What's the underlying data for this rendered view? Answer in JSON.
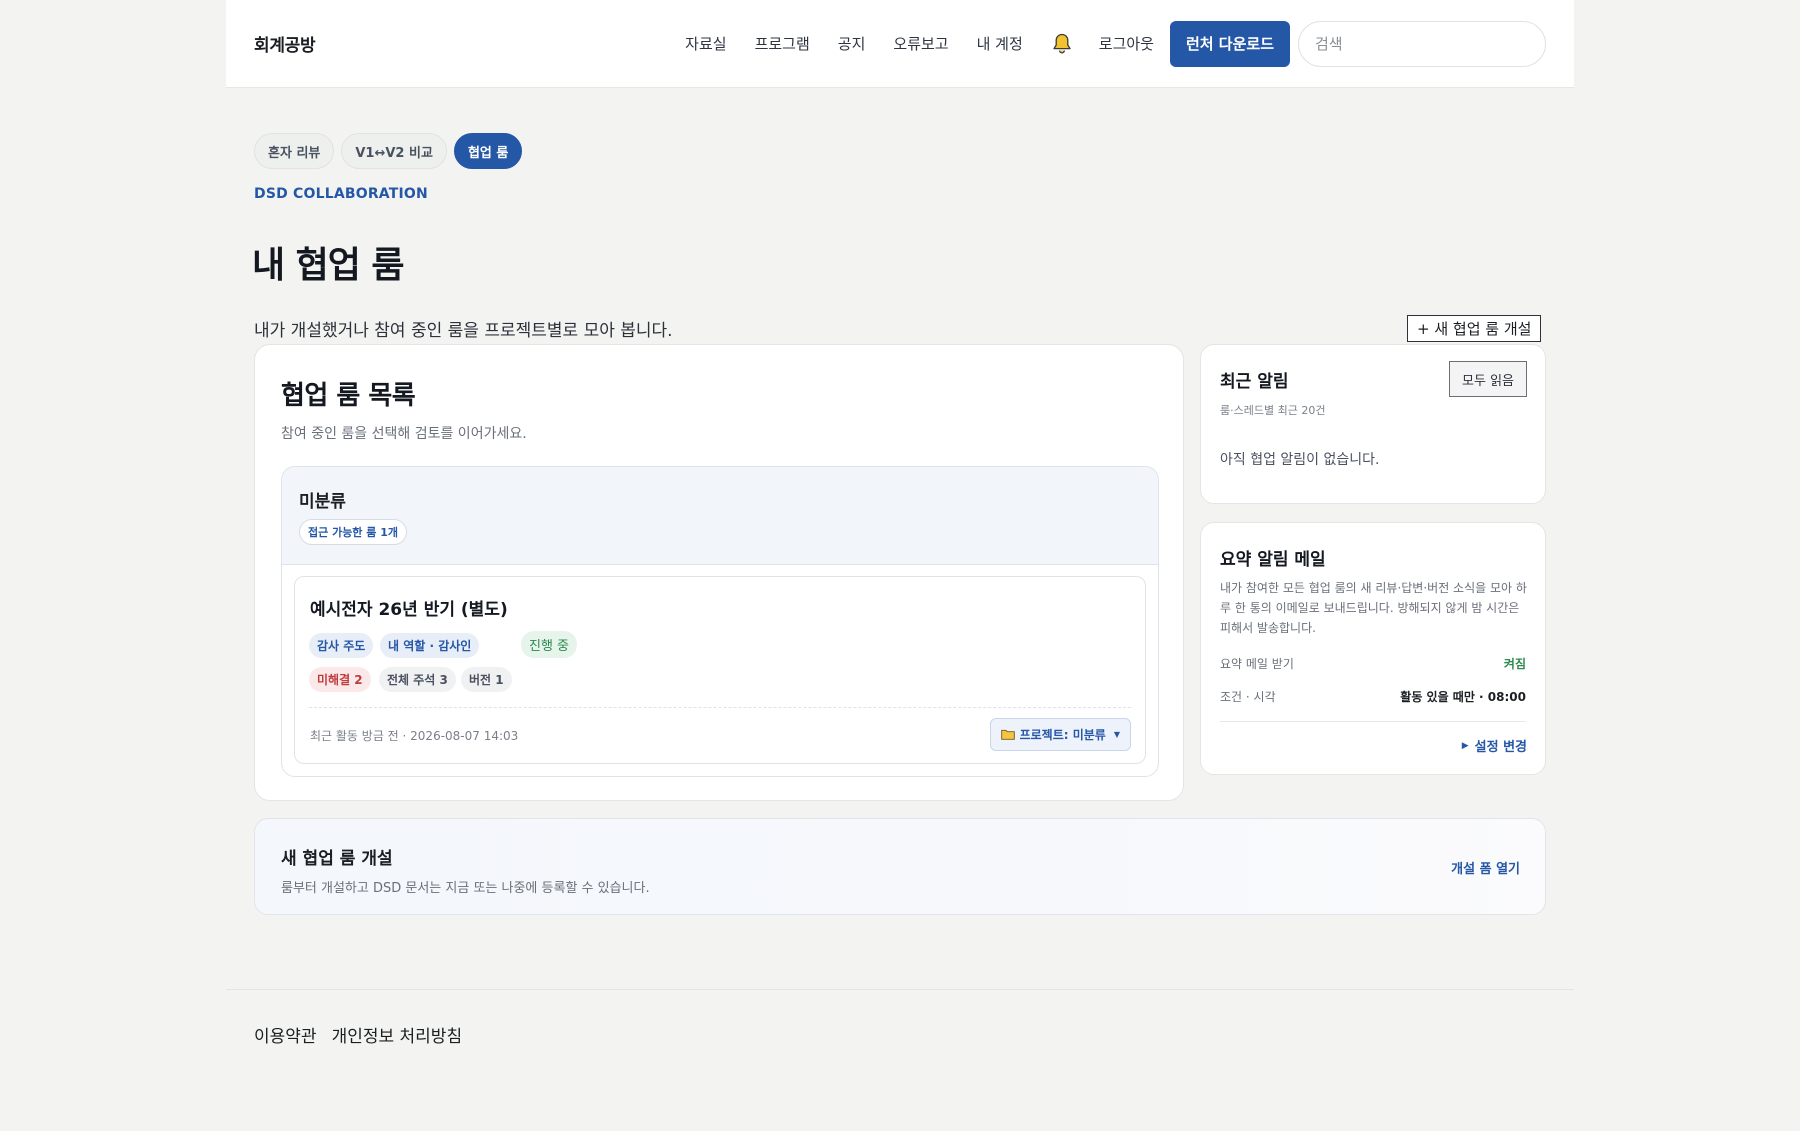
{
  "header": {
    "logo": "회계공방",
    "nav": [
      "자료실",
      "프로그램",
      "공지",
      "오류보고",
      "내 계정"
    ],
    "logout": "로그아웃",
    "download": "런처 다운로드",
    "search_placeholder": "검색"
  },
  "tabs": [
    "혼자 리뷰",
    "V1↔V2 비교",
    "협업 룸"
  ],
  "eyebrow": "DSD COLLABORATION",
  "title": "내 협업 룸",
  "description": "내가 개설했거나 참여 중인 룸을 프로젝트별로 모아 봅니다.",
  "new_room_button": "+ 새 협업 룸 개설",
  "room_list": {
    "title": "협업 룸 목록",
    "subtitle": "참여 중인 룸을 선택해 검토를 이어가세요.",
    "group": {
      "name": "미분류",
      "count": "접근 가능한 룸 1개",
      "room": {
        "name": "예시전자 26년 반기 (별도)",
        "lead": "감사 주도",
        "role": "내 역할 · 감사인",
        "status": "진행 중",
        "unresolved": "미해결 2",
        "comments": "전체 주석 3",
        "version": "버전 1",
        "activity": "최근 활동 방금 전 · 2026-08-07 14:03",
        "project": "프로젝트: 미분류"
      }
    }
  },
  "alerts": {
    "title": "최근 알림",
    "subtitle": "룸·스레드별 최근 20건",
    "read_all": "모두 읽음",
    "empty": "아직 협업 알림이 없습니다."
  },
  "digest": {
    "title": "요약 알림 메일",
    "description": "내가 참여한 모든 협업 룸의 새 리뷰·답변·버전 소식을 모아 하루 한 통의 이메일로 보내드립니다. 방해되지 않게 밤 시간은 피해서 발송합니다.",
    "receive_label": "요약 메일 받기",
    "receive_value": "켜짐",
    "condition_label": "조건 · 시각",
    "condition_value": "활동 있을 때만 · 08:00",
    "settings_link": "설정 변경"
  },
  "create": {
    "title": "새 협업 룸 개설",
    "subtitle": "룸부터 개설하고 DSD 문서는 지금 또는 나중에 등록할 수 있습니다.",
    "link": "개설 폼 열기"
  },
  "footer": [
    "이용약관",
    "개인정보 처리방침"
  ],
  "colors": {
    "accent": "#2557a7",
    "success": "#2b8a4d",
    "danger": "#c23b3b",
    "bell": "#f2c230"
  },
  "icons": {
    "bell": "bell-icon",
    "folder": "folder-icon",
    "caret": "caret-down-icon",
    "settings_arrow": "play-triangle-icon"
  }
}
